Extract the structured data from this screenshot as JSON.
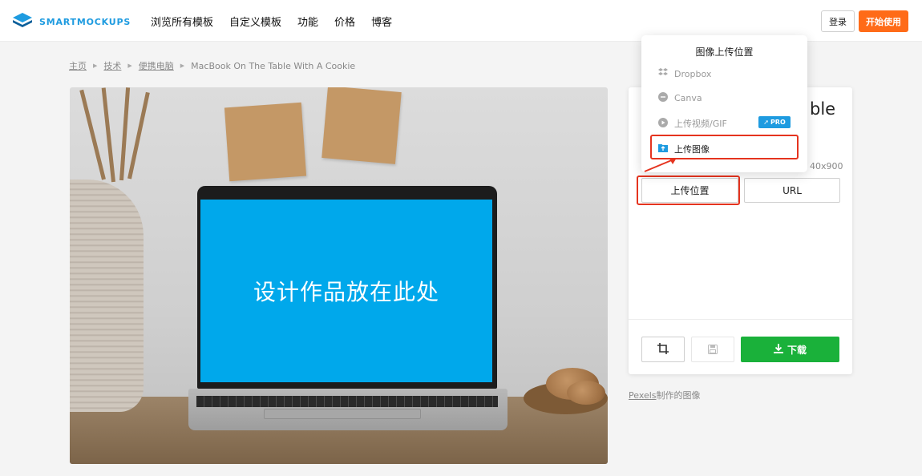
{
  "header": {
    "brand": "SMARTMOCKUPS",
    "nav": [
      "浏览所有模板",
      "自定义模板",
      "功能",
      "价格",
      "博客"
    ],
    "login_label": "登录",
    "start_label": "开始使用"
  },
  "breadcrumb": {
    "items": [
      "主页",
      "技术",
      "便携电脑"
    ],
    "current": "MacBook On The Table With A Cookie"
  },
  "mockup": {
    "placeholder_text": "设计作品放在此处",
    "screen_color": "#00a8eb"
  },
  "panel": {
    "title_fragment": "ble",
    "size_fragment": "40x900",
    "upload_location_label": "上传位置",
    "url_label": "URL",
    "download_label": "下载",
    "crop_icon": "crop-icon",
    "save_icon": "save-icon",
    "download_icon": "download-icon"
  },
  "credit": {
    "link_text": "Pexels",
    "suffix": "制作的图像"
  },
  "dropdown": {
    "title": "图像上传位置",
    "items": [
      {
        "label": "Dropbox",
        "icon": "dropbox-icon"
      },
      {
        "label": "Canva",
        "icon": "canva-icon"
      },
      {
        "label": "上传视频/GIF",
        "icon": "play-icon"
      },
      {
        "label": "上传图像",
        "icon": "upload-image-icon"
      }
    ],
    "pro_label": "PRO"
  },
  "colors": {
    "brand_blue": "#1e9be0",
    "start_orange": "#ff6b18",
    "download_green": "#1ab13a",
    "highlight_red": "#e5341f"
  }
}
